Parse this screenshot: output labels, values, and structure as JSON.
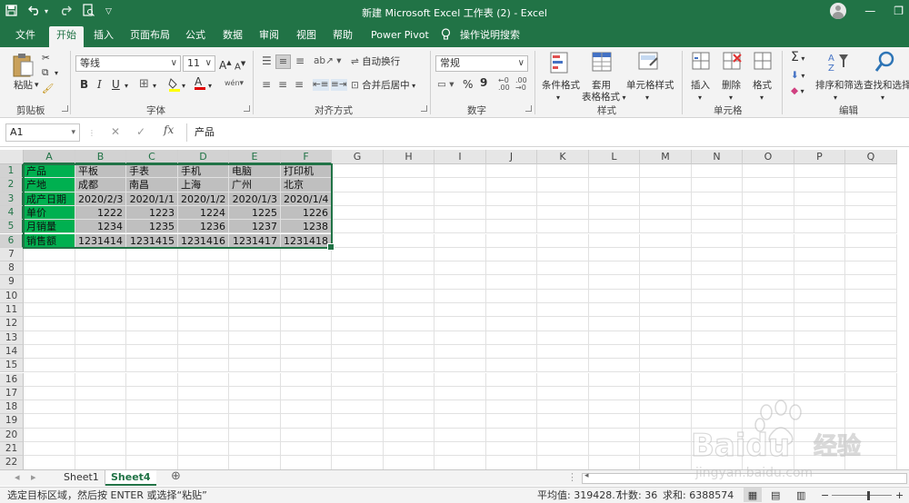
{
  "titlebar": {
    "title": "新建 Microsoft Excel 工作表 (2)  -  Excel",
    "qat": [
      "save-icon",
      "undo-icon",
      "redo-icon",
      "print-preview-icon",
      "customize-icon"
    ],
    "window_buttons": [
      "minimize-icon",
      "restore-icon"
    ]
  },
  "tabs": [
    "文件",
    "开始",
    "插入",
    "页面布局",
    "公式",
    "数据",
    "审阅",
    "视图",
    "帮助",
    "Power Pivot"
  ],
  "tell_me": "操作说明搜索",
  "ribbon": {
    "clipboard": {
      "paste": "粘贴",
      "label": "剪贴板"
    },
    "font": {
      "name": "等线",
      "size": "11",
      "label": "字体",
      "bold": "B",
      "italic": "I",
      "underline": "U",
      "grow": "A",
      "shrink": "A",
      "color_glyph": "A",
      "phonetic": "wén"
    },
    "alignment": {
      "wrap": "自动换行",
      "merge": "合并后居中",
      "label": "对齐方式"
    },
    "number": {
      "format": "常规",
      "percent": "%",
      "comma": "9",
      "label": "数字"
    },
    "styles": {
      "conditional": "条件格式",
      "table_line1": "套用",
      "table_line2": "表格格式",
      "cell_styles": "单元格样式",
      "label": "样式"
    },
    "cells": {
      "insert": "插入",
      "delete": "删除",
      "format": "格式",
      "label": "单元格"
    },
    "editing": {
      "sigma": "Σ",
      "sort": "排序和筛选",
      "find": "查找和选择",
      "label": "编辑"
    }
  },
  "formula_bar": {
    "name_box": "A1",
    "fx": "fx",
    "value": "产品"
  },
  "columns": [
    "A",
    "B",
    "C",
    "D",
    "E",
    "F",
    "G",
    "H",
    "I",
    "J",
    "K",
    "L",
    "M",
    "N",
    "O",
    "P",
    "Q"
  ],
  "rows": [
    "1",
    "2",
    "3",
    "4",
    "5",
    "6",
    "7",
    "8",
    "9",
    "10",
    "11",
    "12",
    "13",
    "14",
    "15",
    "16",
    "17",
    "18",
    "19",
    "20",
    "21",
    "22"
  ],
  "cells": [
    [
      "产品",
      "平板",
      "手表",
      "手机",
      "电脑",
      "打印机"
    ],
    [
      "产地",
      "成都",
      "南昌",
      "上海",
      "广州",
      "北京"
    ],
    [
      "成产日期",
      "2020/2/3",
      "2020/1/1",
      "2020/1/2",
      "2020/1/3",
      "2020/1/4"
    ],
    [
      "单价",
      "1222",
      "1223",
      "1224",
      "1225",
      "1226"
    ],
    [
      "月销量",
      "1234",
      "1235",
      "1236",
      "1237",
      "1238"
    ],
    [
      "销售额",
      "1231414",
      "1231415",
      "1231416",
      "1231417",
      "1231418"
    ]
  ],
  "colors": {
    "accent": "#217346",
    "header_fill": "#00b050",
    "data_fill": "#bfbfbf"
  },
  "sheets": [
    {
      "name": "Sheet1",
      "active": false
    },
    {
      "name": "Sheet4",
      "active": true
    }
  ],
  "status": {
    "message": "选定目标区域，然后按 ENTER 或选择“粘贴”",
    "average": "平均值: 319428.7",
    "count": "计数: 36",
    "sum": "求和: 6388574"
  },
  "watermark": {
    "brand": "Baidu",
    "tagline": "经验",
    "url": "jingyan.baidu.com"
  }
}
